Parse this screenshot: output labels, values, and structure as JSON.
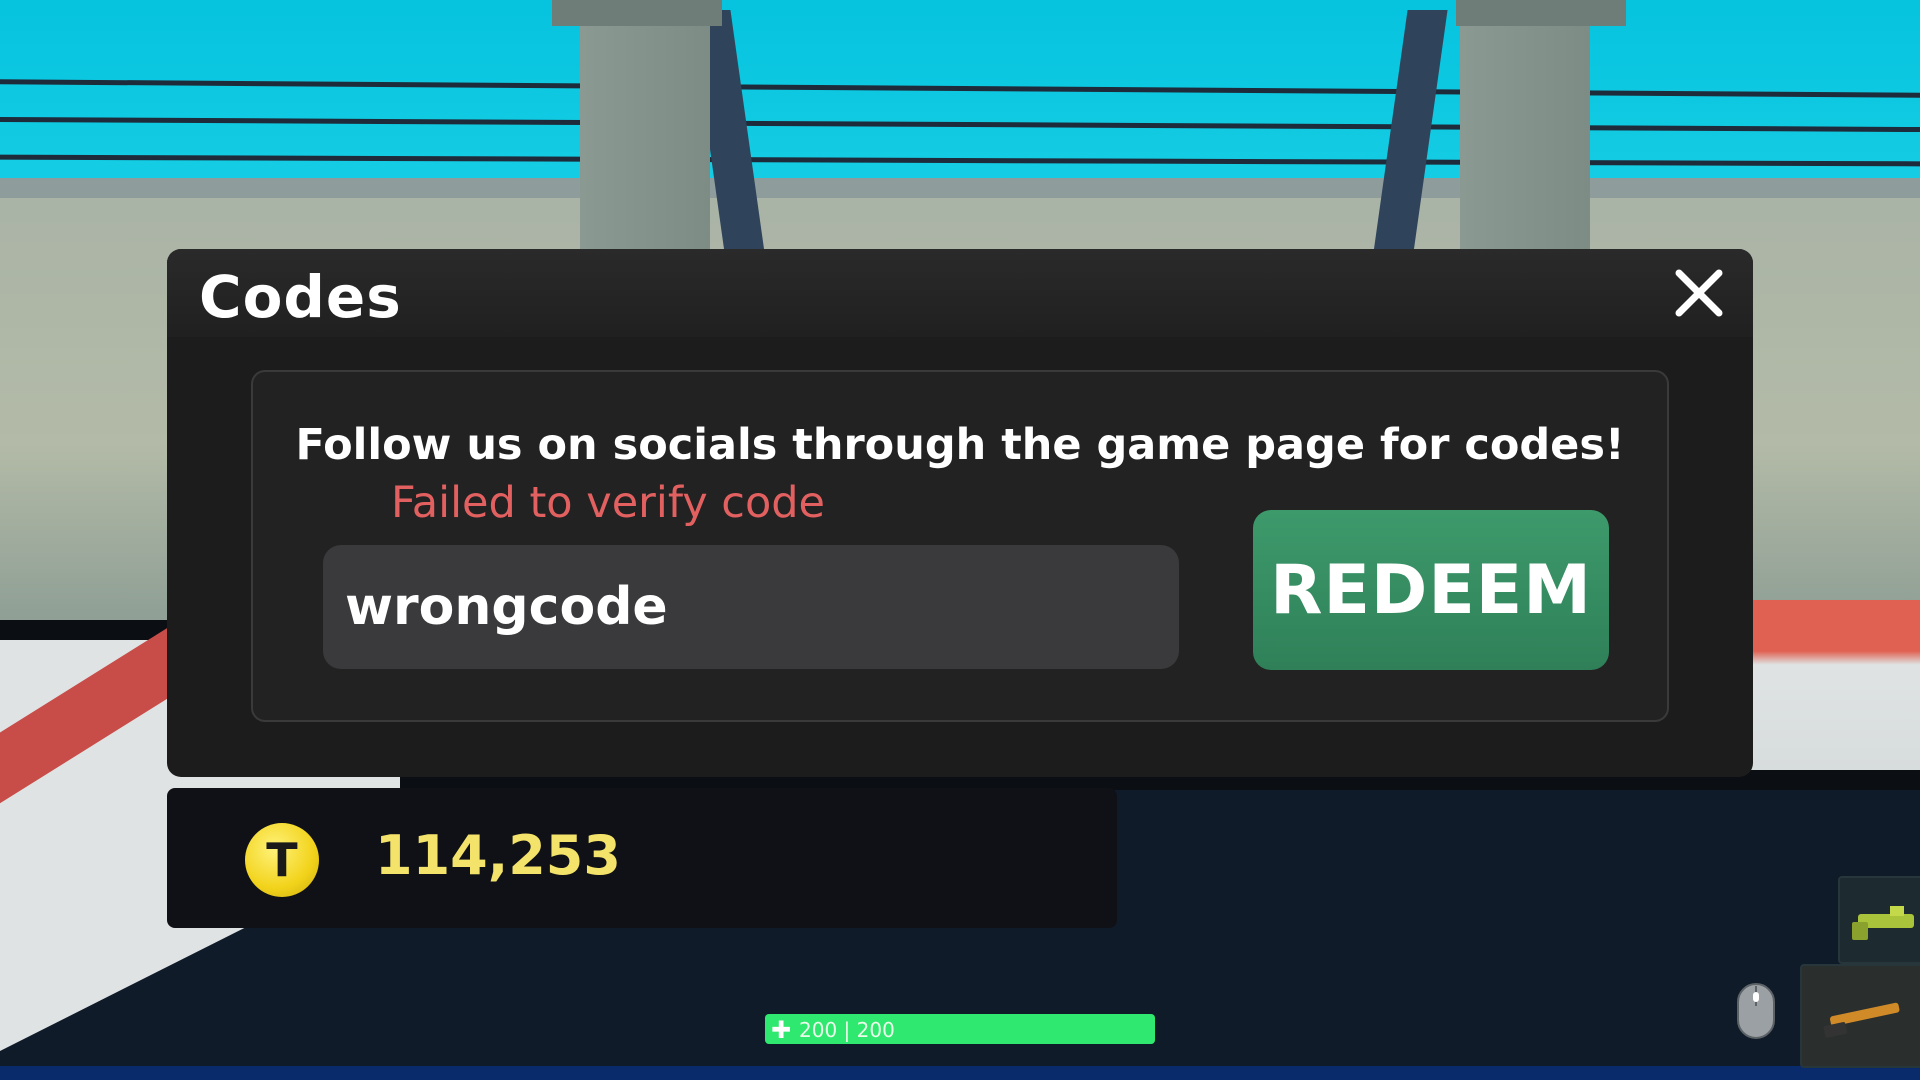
{
  "modal": {
    "title": "Codes",
    "instructions": "Follow us on socials through the game page for codes!",
    "error": "Failed to verify code",
    "input_value": "wrongcode",
    "redeem_label": "REDEEM"
  },
  "currency": {
    "icon_letter": "T",
    "value": "114,253"
  },
  "health": {
    "current": "200",
    "max": "200",
    "fraction": 1.0
  },
  "colors": {
    "error": "#e26160",
    "redeem": "#2f8058",
    "currency_text": "#f4e36a",
    "health_fill": "#2fe86f"
  },
  "icons": {
    "close": "close-icon",
    "coin": "coin-icon",
    "mouse": "mouse-icon",
    "weapon_primary": "rifle-icon",
    "weapon_secondary": "gun-icon"
  }
}
